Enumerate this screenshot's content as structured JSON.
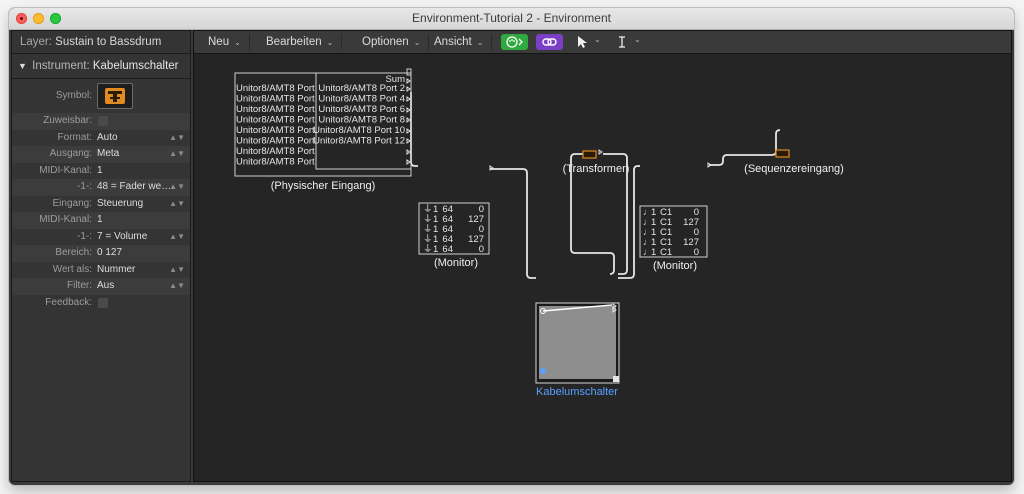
{
  "window": {
    "title": "Environment-Tutorial 2 - Environment"
  },
  "inspector": {
    "layer_label": "Layer:",
    "layer_value": "Sustain to Bassdrum",
    "instrument_label": "Instrument:",
    "instrument_value": "Kabelumschalter",
    "params": [
      {
        "label": "Symbol:",
        "value": "",
        "kind": "symbol"
      },
      {
        "label": "Zuweisbar:",
        "value": "",
        "kind": "checkbox"
      },
      {
        "label": "Format:",
        "value": "Auto",
        "kind": "select"
      },
      {
        "label": "Ausgang:",
        "value": "Meta",
        "kind": "select"
      },
      {
        "label": "MIDI-Kanal:",
        "value": "1",
        "kind": "text"
      },
      {
        "label": "-1-:",
        "value": "48 = Fader we…",
        "kind": "select"
      },
      {
        "label": "Eingang:",
        "value": "Steuerung",
        "kind": "select"
      },
      {
        "label": "MIDI-Kanal:",
        "value": "1",
        "kind": "text"
      },
      {
        "label": "-1-:",
        "value": "7 = Volume",
        "kind": "select"
      },
      {
        "label": "Bereich:",
        "value": "0  127",
        "kind": "text"
      },
      {
        "label": "Wert als:",
        "value": "Nummer",
        "kind": "select"
      },
      {
        "label": "Filter:",
        "value": "Aus",
        "kind": "select"
      },
      {
        "label": "Feedback:",
        "value": "",
        "kind": "checkbox"
      }
    ]
  },
  "toolbar": {
    "menus": [
      "Neu",
      "Bearbeiten",
      "Optionen",
      "Ansicht"
    ],
    "midi_button_icon": "midi-thru-icon",
    "link_button_icon": "link-icon",
    "pointer_tool_icon": "arrow-pointer-icon",
    "text_tool_icon": "text-cursor-icon",
    "green": "#2faa3f",
    "purple": "#7b3fc6"
  },
  "canvas": {
    "physical_input": {
      "label": "(Physischer Eingang)",
      "sum_label": "Sum",
      "left_ports": [
        "Unitor8/AMT8 Port",
        "Unitor8/AMT8 Port",
        "Unitor8/AMT8 Port",
        "Unitor8/AMT8 Port",
        "Unitor8/AMT8 Port",
        "Unitor8/AMT8 Port",
        "Unitor8/AMT8 Port",
        "Unitor8/AMT8 Port"
      ],
      "right_ports": [
        "Unitor8/AMT8 Port 2",
        "Unitor8/AMT8 Port 4",
        "Unitor8/AMT8 Port 6",
        "Unitor8/AMT8 Port 8",
        "Unitor8/AMT8 Port 10",
        "Unitor8/AMT8 Port 12"
      ]
    },
    "monitor1": {
      "label": "(Monitor)",
      "rows": [
        {
          "ch": "1",
          "a": "64",
          "b": "0"
        },
        {
          "ch": "1",
          "a": "64",
          "b": "127"
        },
        {
          "ch": "1",
          "a": "64",
          "b": "0"
        },
        {
          "ch": "1",
          "a": "64",
          "b": "127"
        },
        {
          "ch": "1",
          "a": "64",
          "b": "0"
        }
      ]
    },
    "monitor2": {
      "label": "(Monitor)",
      "rows": [
        {
          "ch": "1",
          "a": "C1",
          "b": "0"
        },
        {
          "ch": "1",
          "a": "C1",
          "b": "127"
        },
        {
          "ch": "1",
          "a": "C1",
          "b": "0"
        },
        {
          "ch": "1",
          "a": "C1",
          "b": "127"
        },
        {
          "ch": "1",
          "a": "C1",
          "b": "0"
        }
      ]
    },
    "transformer": {
      "label": "(Transformer)"
    },
    "sequencer_input": {
      "label": "(Sequenzereingang)"
    },
    "cable_switcher": {
      "label": "Kabelumschalter",
      "label_color": "#5aa0ff"
    }
  }
}
